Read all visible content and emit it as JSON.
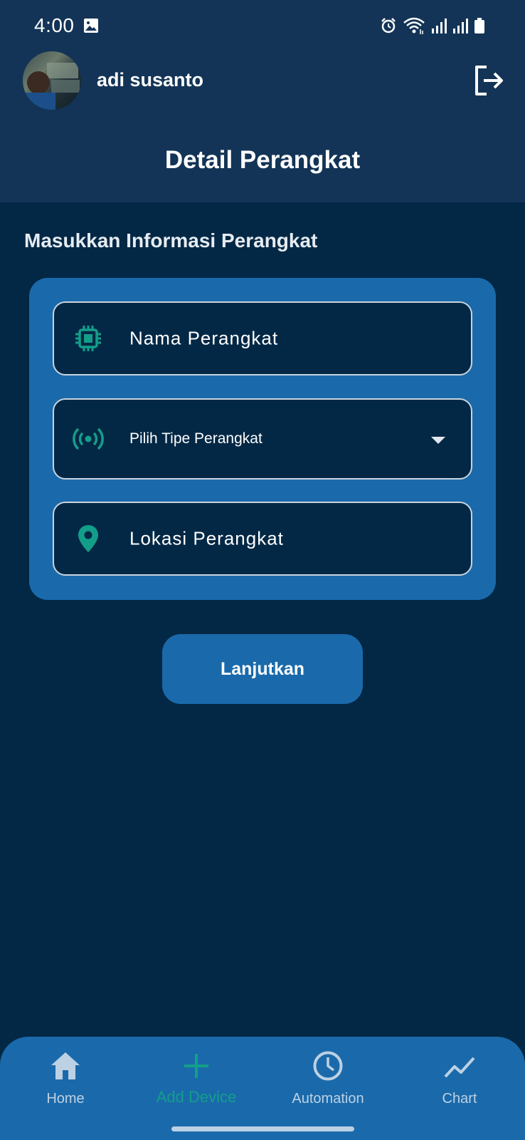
{
  "status_bar": {
    "time": "4:00",
    "icons": [
      "gallery-icon",
      "alarm-icon",
      "wifi-icon",
      "signal-icon",
      "signal-icon",
      "battery-icon"
    ]
  },
  "header": {
    "user_name": "adi susanto",
    "title": "Detail Perangkat",
    "logout_icon": "logout-icon"
  },
  "form": {
    "section_title": "Masukkan Informasi Perangkat",
    "fields": [
      {
        "icon": "chip-icon",
        "placeholder": "Nama Perangkat"
      },
      {
        "icon": "broadcast-icon",
        "placeholder": "Pilih Tipe Perangkat",
        "dropdown": true
      },
      {
        "icon": "location-pin-icon",
        "placeholder": "Lokasi Perangkat"
      }
    ],
    "submit_label": "Lanjutkan"
  },
  "bottom_nav": {
    "items": [
      {
        "label": "Home",
        "icon": "home-icon"
      },
      {
        "label": "Add Device",
        "icon": "plus-icon",
        "active": true
      },
      {
        "label": "Automation",
        "icon": "clock-icon"
      },
      {
        "label": "Chart",
        "icon": "chart-line-icon"
      }
    ]
  },
  "colors": {
    "background": "#032845",
    "header": "#133456",
    "accent": "#1a6aab",
    "icon_teal": "#139e8a"
  }
}
